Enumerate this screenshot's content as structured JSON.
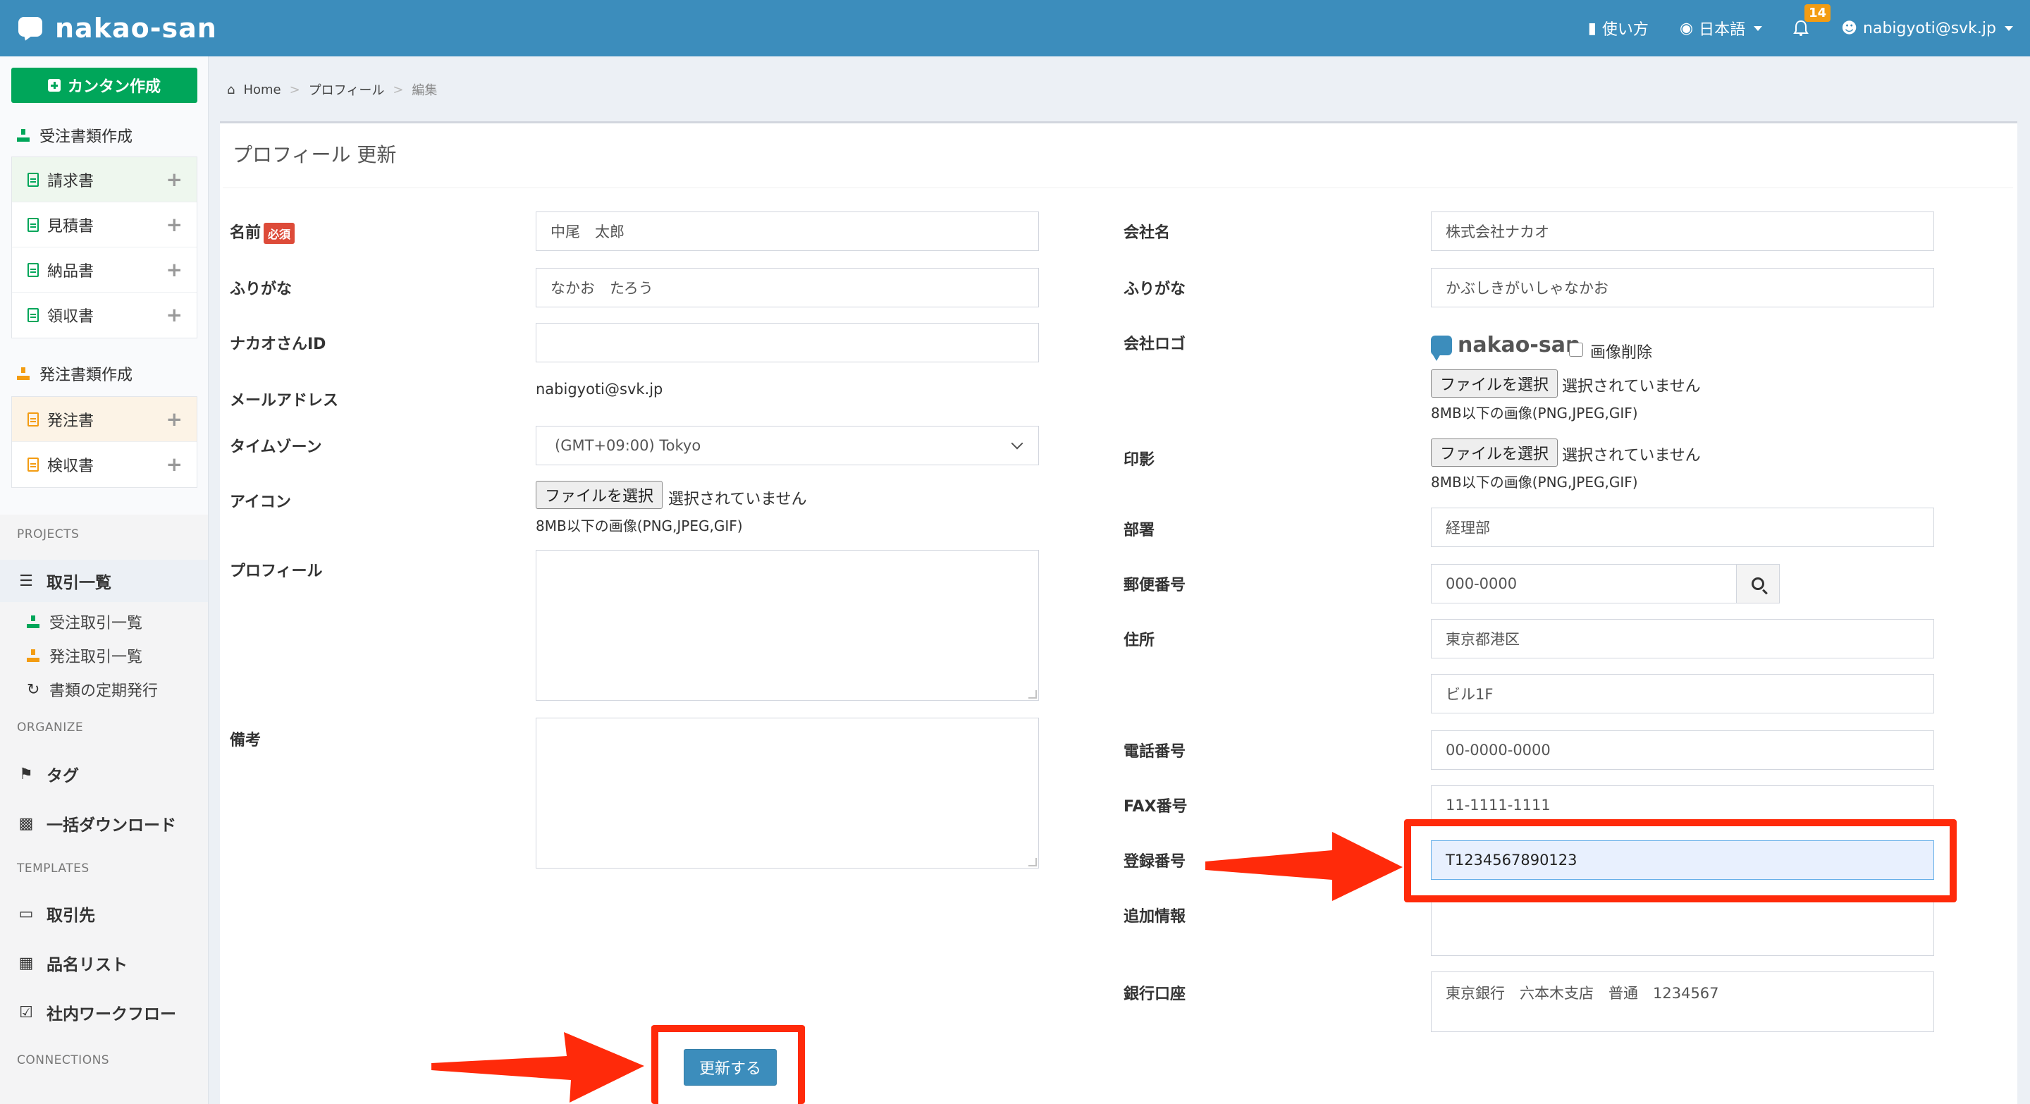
{
  "app": {
    "brand": "nakao-san",
    "nav": {
      "help": "使い方",
      "language": "日本語",
      "notifications_count": "14",
      "user_email": "nabigyoti@svk.jp"
    }
  },
  "sidebar": {
    "quick_create": "カンタン作成",
    "receive_section": "受注書類作成",
    "receive_docs": [
      "請求書",
      "見積書",
      "納品書",
      "領収書"
    ],
    "order_section": "発注書類作成",
    "order_docs": [
      "発注書",
      "検収書"
    ],
    "categories": {
      "projects": "PROJECTS",
      "organize": "ORGANIZE",
      "templates": "TEMPLATES",
      "connections": "CONNECTIONS"
    },
    "projects": {
      "deals": "取引一覧",
      "received_deals": "受注取引一覧",
      "ordered_deals": "発注取引一覧",
      "recurring": "書類の定期発行"
    },
    "organize": {
      "tags": "タグ",
      "bulk_download": "一括ダウンロード"
    },
    "templates": {
      "clients": "取引先",
      "items": "品名リスト",
      "workflow": "社内ワークフロー"
    }
  },
  "breadcrumb": [
    "Home",
    "プロフィール",
    "編集"
  ],
  "page_title": "プロフィール 更新",
  "form": {
    "left": {
      "name_label": "名前",
      "required_badge": "必須",
      "name_value": "中尾　太郎",
      "furigana_label": "ふりがな",
      "furigana_value": "なかお　たろう",
      "nakao_id_label": "ナカオさんID",
      "nakao_id_value": "",
      "email_label": "メールアドレス",
      "email_value": "nabigyoti@svk.jp",
      "timezone_label": "タイムゾーン",
      "timezone_value": "(GMT+09:00) Tokyo",
      "icon_label": "アイコン",
      "file_button": "ファイルを選択",
      "file_none": "選択されていません",
      "file_hint": "8MB以下の画像(PNG,JPEG,GIF)",
      "profile_label": "プロフィール",
      "notes_label": "備考"
    },
    "right": {
      "company_label": "会社名",
      "company_value": "株式会社ナカオ",
      "company_furigana_label": "ふりがな",
      "company_furigana_value": "かぶしきがいしゃなかお",
      "logo_label": "会社ロゴ",
      "logo_text": "nakao-san",
      "delete_image": "画像削除",
      "file_button": "ファイルを選択",
      "file_none": "選択されていません",
      "file_hint": "8MB以下の画像(PNG,JPEG,GIF)",
      "seal_label": "印影",
      "department_label": "部署",
      "department_value": "経理部",
      "postal_label": "郵便番号",
      "postal_value": "000-0000",
      "address_label": "住所",
      "address1_value": "東京都港区",
      "address2_value": "ビル1F",
      "phone_label": "電話番号",
      "phone_value": "00-0000-0000",
      "fax_label": "FAX番号",
      "fax_value": "11-1111-1111",
      "registration_label": "登録番号",
      "registration_value": "T1234567890123",
      "extra_label": "追加情報",
      "extra_value": "",
      "bank_label": "銀行口座",
      "bank_value": "東京銀行　六本木支店　普通　1234567"
    },
    "submit": "更新する"
  },
  "colors": {
    "header": "#3c8dbc",
    "quick_create": "#00a65a",
    "badge": "#f39c12",
    "required": "#dd4b39",
    "highlight": "#ff2a0a"
  }
}
